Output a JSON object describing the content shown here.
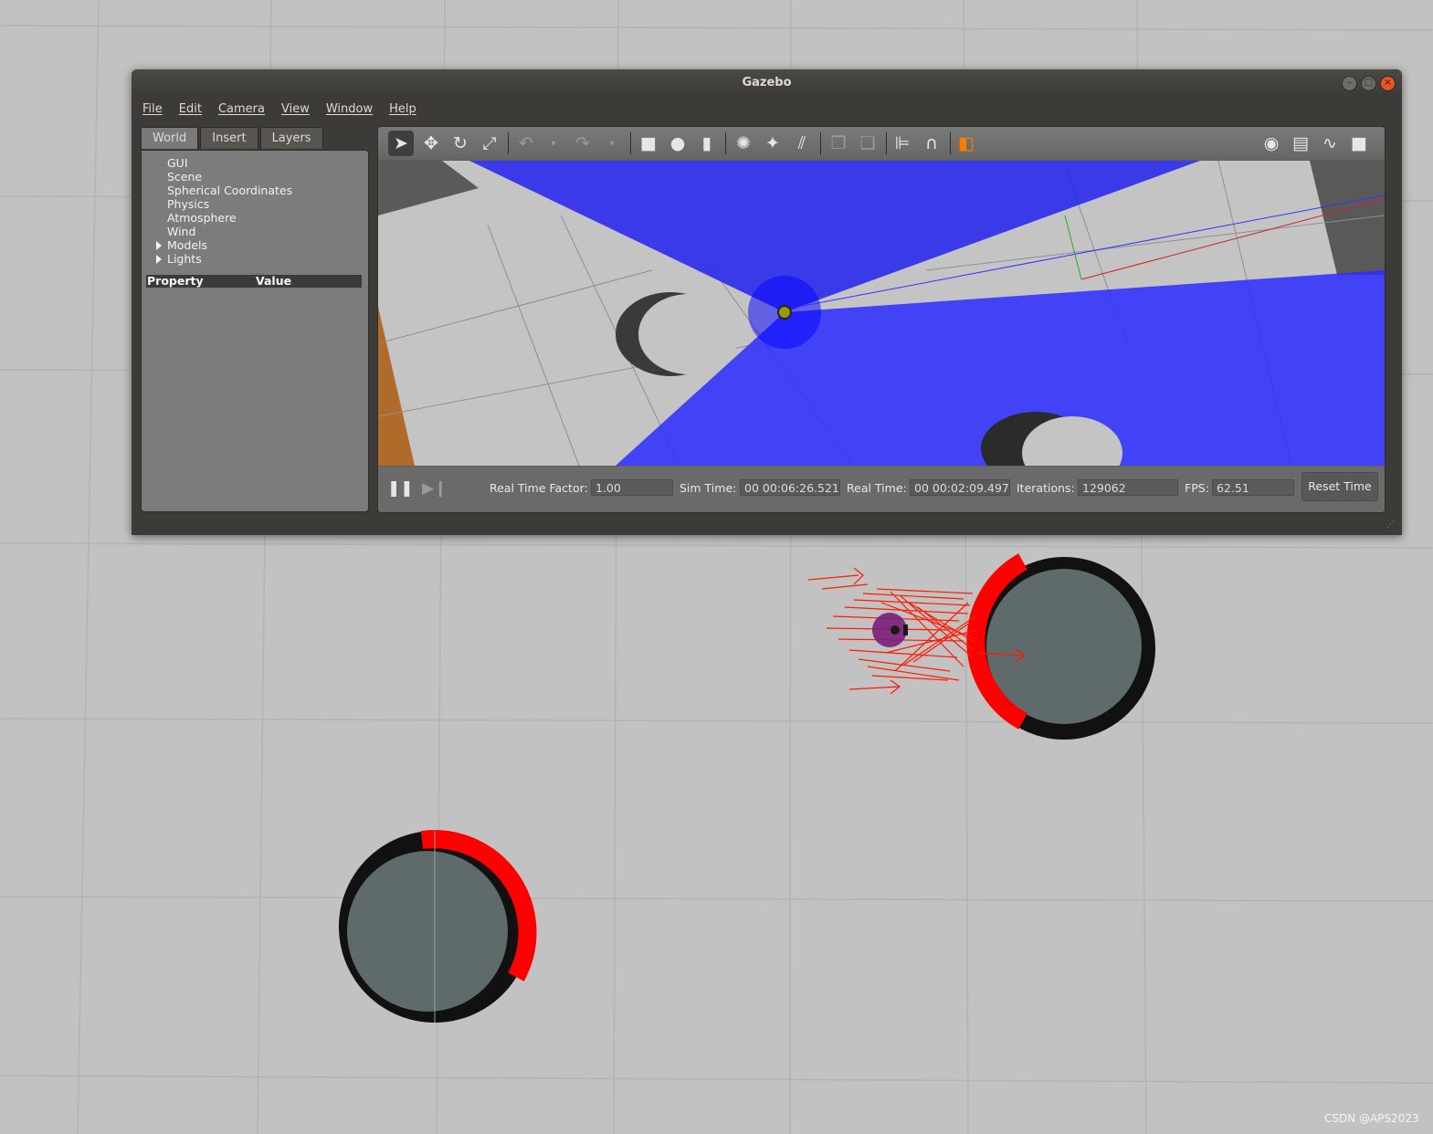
{
  "window": {
    "title": "Gazebo"
  },
  "menu": [
    "File",
    "Edit",
    "Camera",
    "View",
    "Window",
    "Help"
  ],
  "left_panel": {
    "tabs": [
      "World",
      "Insert",
      "Layers"
    ],
    "tree": [
      "GUI",
      "Scene",
      "Spherical Coordinates",
      "Physics",
      "Atmosphere",
      "Wind",
      "Models",
      "Lights"
    ],
    "property_header": "Property",
    "value_header": "Value"
  },
  "toolbar": {
    "tools": [
      "select-mode",
      "translate-mode",
      "rotate-mode",
      "scale-mode",
      "undo",
      "redo",
      "box",
      "sphere",
      "cylinder",
      "point-light",
      "spot-light",
      "directional-light",
      "copy",
      "paste",
      "align",
      "snap",
      "view-angle"
    ],
    "right_tools": [
      "screenshot",
      "log",
      "plot",
      "video-record"
    ]
  },
  "bottom_bar": {
    "real_time_factor_label": "Real Time Factor:",
    "real_time_factor": "1.00",
    "sim_time_label": "Sim Time:",
    "sim_time": "00 00:06:26.521",
    "real_time_label": "Real Time:",
    "real_time": "00 00:02:09.497",
    "iterations_label": "Iterations:",
    "iterations": "129062",
    "fps_label": "FPS:",
    "fps": "62.51",
    "reset_button": "Reset Time"
  },
  "watermark": "CSDN @APS2023",
  "colors": {
    "rviz_background": "#c2c2c2",
    "costmap_obstacle": "#5f6b6b",
    "inflation_edge": "#ff0000",
    "laser_scan": "#2a2aff",
    "robot": "#7a1f7a",
    "particle_arrows": "#ff1a00"
  }
}
